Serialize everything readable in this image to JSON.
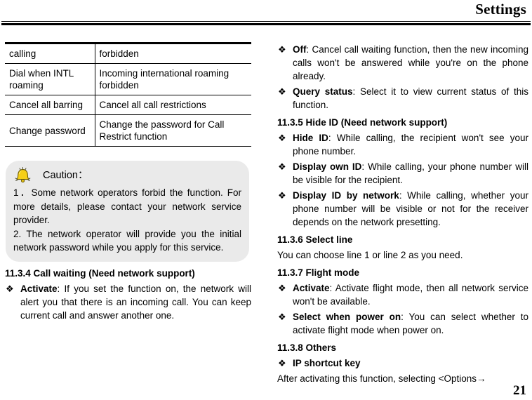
{
  "header": {
    "title": "Settings"
  },
  "table": {
    "rows": [
      {
        "left": "calling",
        "right": "forbidden"
      },
      {
        "left": "Dial when INTL roaming",
        "right": "Incoming international roaming forbidden"
      },
      {
        "left": "Cancel all barring",
        "right": "Cancel all call restrictions"
      },
      {
        "left": "Change password",
        "right": "Change the password for Call Restrict function"
      }
    ]
  },
  "caution": {
    "icon": "bell-icon",
    "label": "Caution：",
    "paragraph1": "1．Some network operators forbid the function. For more details, please contact your network service provider.",
    "paragraph2": "2. The network operator will provide you the initial network password while you apply for this service."
  },
  "left_column": {
    "section": {
      "heading": "11.3.4 Call waiting (Need network support)",
      "bullet": {
        "mark": "❖",
        "lead": "Activate",
        "text": ": If you set the function on, the network will alert you that there is an incoming call. You can keep current call and answer another one."
      }
    }
  },
  "right_column": {
    "blocks": [
      {
        "kind": "bullet",
        "mark": "❖",
        "lead": "Off",
        "text": ": Cancel call waiting function, then the new incoming calls won't be answered while you're on the phone already."
      },
      {
        "kind": "bullet",
        "mark": "❖",
        "lead": "Query status",
        "text": ": Select it to view current status of this function."
      },
      {
        "kind": "heading",
        "text": "11.3.5 Hide ID (Need network support)"
      },
      {
        "kind": "bullet",
        "mark": "❖",
        "lead": "Hide ID",
        "text": ": While calling, the recipient won't see your phone number."
      },
      {
        "kind": "bullet",
        "mark": "❖",
        "lead": "Display own ID",
        "text": ": While calling, your phone number will be visible for the recipient."
      },
      {
        "kind": "bullet",
        "mark": "❖",
        "lead": "Display ID by network",
        "text": ": While calling, whether your phone number will be visible or not for the receiver depends on the network presetting."
      },
      {
        "kind": "heading",
        "text": "11.3.6 Select line"
      },
      {
        "kind": "para",
        "text": "You can choose line 1 or line 2 as you need."
      },
      {
        "kind": "heading",
        "text": "11.3.7 Flight mode"
      },
      {
        "kind": "bullet",
        "mark": "❖",
        "lead": "Activate",
        "text": ": Activate flight mode, then all network service won't be available."
      },
      {
        "kind": "bullet",
        "mark": "❖",
        "lead": "Select when power on",
        "text": ": You can select whether to activate flight mode when power on."
      },
      {
        "kind": "heading",
        "text": "11.3.8 Others"
      },
      {
        "kind": "bullet",
        "mark": "❖",
        "lead": "IP shortcut key",
        "text": ""
      },
      {
        "kind": "para-rich",
        "text_before": "After activating this function, selecting <",
        "bold_part": "Options",
        "text_after": "→"
      }
    ]
  },
  "footer": {
    "page_number": "21"
  }
}
